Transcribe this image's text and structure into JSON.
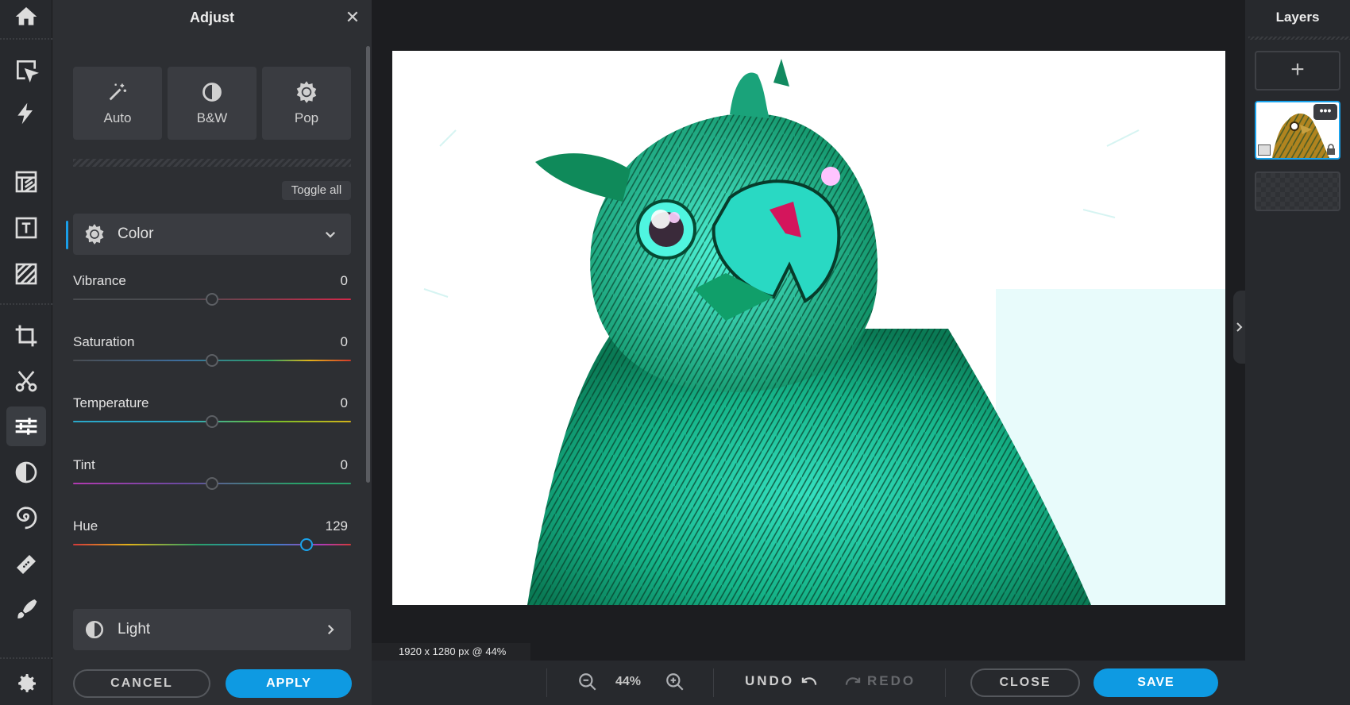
{
  "rail": {
    "items": [
      {
        "name": "home-icon"
      },
      {
        "name": "arrange-icon"
      },
      {
        "name": "quick-actions-icon"
      },
      {
        "name": "templates-icon"
      },
      {
        "name": "text-icon"
      },
      {
        "name": "effects-icon"
      },
      {
        "name": "crop-icon"
      },
      {
        "name": "cutout-icon"
      },
      {
        "name": "adjust-icon",
        "active": true
      },
      {
        "name": "filters-icon"
      },
      {
        "name": "liquify-icon"
      },
      {
        "name": "retouch-icon"
      },
      {
        "name": "draw-icon"
      },
      {
        "name": "settings-icon"
      }
    ]
  },
  "adjust": {
    "title": "Adjust",
    "presets": [
      {
        "label": "Auto",
        "icon": "magic-wand-icon"
      },
      {
        "label": "B&W",
        "icon": "contrast-icon"
      },
      {
        "label": "Pop",
        "icon": "sun-icon"
      }
    ],
    "toggle_all": "Toggle all",
    "color_section": {
      "label": "Color",
      "icon": "sun-icon",
      "expanded": true
    },
    "sliders": [
      {
        "label": "Vibrance",
        "value": "0",
        "position": 0.5
      },
      {
        "label": "Saturation",
        "value": "0",
        "position": 0.5
      },
      {
        "label": "Temperature",
        "value": "0",
        "position": 0.5
      },
      {
        "label": "Tint",
        "value": "0",
        "position": 0.5
      },
      {
        "label": "Hue",
        "value": "129",
        "position": 0.84
      }
    ],
    "light_section": {
      "label": "Light",
      "icon": "contrast-icon",
      "expanded": false
    },
    "cancel": "CANCEL",
    "apply": "APPLY"
  },
  "canvas": {
    "dimensions": "1920 x 1280 px @ 44%"
  },
  "bottombar": {
    "zoom": "44%",
    "undo": "UNDO",
    "redo": "REDO",
    "close": "CLOSE",
    "save": "SAVE"
  },
  "layers": {
    "title": "Layers",
    "add": "+"
  },
  "colors": {
    "accent": "#0e9ae2",
    "panel": "#2d2f33",
    "rail": "#27292d"
  }
}
